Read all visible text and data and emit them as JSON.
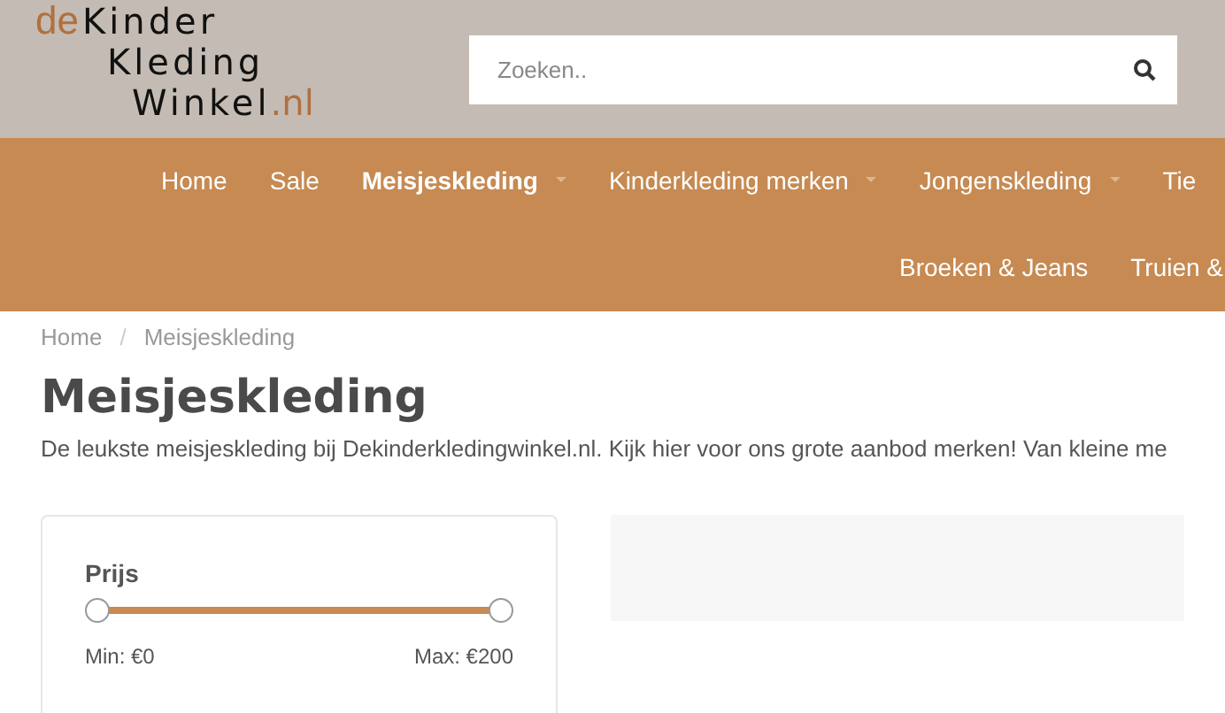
{
  "logo": {
    "prefix": "de",
    "lines": [
      "Kinder",
      "Kleding",
      "Winkel"
    ],
    "suffix": ".nl"
  },
  "search": {
    "placeholder": "Zoeken.."
  },
  "nav": {
    "items": [
      {
        "label": "Home",
        "selected": false,
        "dropdown": false
      },
      {
        "label": "Sale",
        "selected": false,
        "dropdown": false
      },
      {
        "label": "Meisjeskleding",
        "selected": true,
        "dropdown": true
      },
      {
        "label": "Kinderkleding merken",
        "selected": false,
        "dropdown": true
      },
      {
        "label": "Jongenskleding",
        "selected": false,
        "dropdown": true
      },
      {
        "label": "Tie",
        "selected": false,
        "dropdown": false
      }
    ],
    "second_row": [
      {
        "label": "Broeken & Jeans",
        "selected": false,
        "dropdown": false
      },
      {
        "label": "Truien &",
        "selected": false,
        "dropdown": false
      }
    ]
  },
  "breadcrumb": {
    "items": [
      "Home",
      "Meisjeskleding"
    ],
    "separator": "/"
  },
  "title": "Meisjeskleding",
  "description": "De leukste meisjeskleding bij Dekinderkledingwinkel.nl. Kijk hier voor ons grote aanbod merken! Van kleine me",
  "filter": {
    "title": "Prijs",
    "handles": [
      {
        "level": 0
      },
      {
        "level": 1
      }
    ],
    "min_label": "Min: €0",
    "max_label": "Max: €200"
  }
}
